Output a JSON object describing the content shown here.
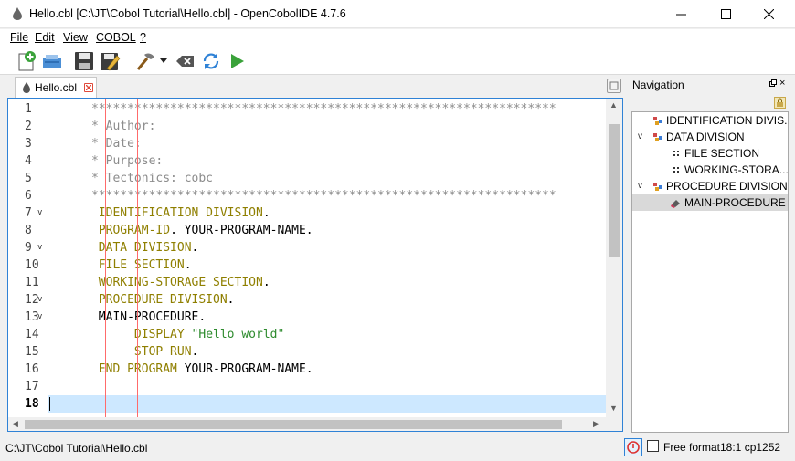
{
  "window": {
    "title": "Hello.cbl [C:\\JT\\Cobol Tutorial\\Hello.cbl] - OpenCobolIDE 4.7.6",
    "minimize_icon": "minimize-icon",
    "maximize_icon": "maximize-icon",
    "close_icon": "close-icon"
  },
  "menu": {
    "items": [
      {
        "label": "File",
        "mnemonic": "F"
      },
      {
        "label": "Edit",
        "mnemonic": "E"
      },
      {
        "label": "View",
        "mnemonic": "V"
      },
      {
        "label": "COBOL",
        "mnemonic": "C"
      },
      {
        "label": "?",
        "mnemonic": "?"
      }
    ]
  },
  "toolbar": {
    "buttons": [
      {
        "icon": "new-file-icon"
      },
      {
        "icon": "open-file-icon"
      },
      {
        "icon": "save-icon"
      },
      {
        "icon": "save-as-icon"
      },
      {
        "icon": "compile-hammer-icon"
      },
      {
        "icon": "dropdown-arrow-icon"
      },
      {
        "icon": "clear-icon"
      },
      {
        "icon": "refresh-icon"
      },
      {
        "icon": "run-icon"
      }
    ]
  },
  "tab": {
    "label": "Hello.cbl",
    "close_icon": "tab-close-icon"
  },
  "editor": {
    "current_line": 18,
    "lines": [
      {
        "n": "1",
        "fold": "",
        "tokens": [
          {
            "t": "      *****************************************************************",
            "c": "comment"
          }
        ]
      },
      {
        "n": "2",
        "fold": "",
        "tokens": [
          {
            "t": "      * Author:",
            "c": "comment"
          }
        ]
      },
      {
        "n": "3",
        "fold": "",
        "tokens": [
          {
            "t": "      * Date:",
            "c": "comment"
          }
        ]
      },
      {
        "n": "4",
        "fold": "",
        "tokens": [
          {
            "t": "      * Purpose:",
            "c": "comment"
          }
        ]
      },
      {
        "n": "5",
        "fold": "",
        "tokens": [
          {
            "t": "      * Tectonics: cobc",
            "c": "comment"
          }
        ]
      },
      {
        "n": "6",
        "fold": "",
        "tokens": [
          {
            "t": "      *****************************************************************",
            "c": "comment"
          }
        ]
      },
      {
        "n": "7",
        "fold": "v",
        "tokens": [
          {
            "t": "       IDENTIFICATION DIVISION",
            "c": "kw"
          },
          {
            "t": ".",
            "c": "id"
          }
        ]
      },
      {
        "n": "8",
        "fold": "",
        "tokens": [
          {
            "t": "       PROGRAM-ID",
            "c": "kw"
          },
          {
            "t": ". YOUR-PROGRAM-NAME.",
            "c": "id"
          }
        ]
      },
      {
        "n": "9",
        "fold": "v",
        "tokens": [
          {
            "t": "       DATA DIVISION",
            "c": "kw"
          },
          {
            "t": ".",
            "c": "id"
          }
        ]
      },
      {
        "n": "10",
        "fold": "",
        "tokens": [
          {
            "t": "       FILE SECTION",
            "c": "kw"
          },
          {
            "t": ".",
            "c": "id"
          }
        ]
      },
      {
        "n": "11",
        "fold": "",
        "tokens": [
          {
            "t": "       WORKING-STORAGE SECTION",
            "c": "kw"
          },
          {
            "t": ".",
            "c": "id"
          }
        ]
      },
      {
        "n": "12",
        "fold": "v",
        "tokens": [
          {
            "t": "       PROCEDURE DIVISION",
            "c": "kw"
          },
          {
            "t": ".",
            "c": "id"
          }
        ]
      },
      {
        "n": "13",
        "fold": "v",
        "tokens": [
          {
            "t": "       MAIN-PROCEDURE.",
            "c": "id"
          }
        ]
      },
      {
        "n": "14",
        "fold": "",
        "tokens": [
          {
            "t": "            DISPLAY ",
            "c": "kw"
          },
          {
            "t": "\"Hello world\"",
            "c": "str"
          }
        ]
      },
      {
        "n": "15",
        "fold": "",
        "tokens": [
          {
            "t": "            STOP RUN",
            "c": "kw"
          },
          {
            "t": ".",
            "c": "id"
          }
        ]
      },
      {
        "n": "16",
        "fold": "",
        "tokens": [
          {
            "t": "       END PROGRAM",
            "c": "kw"
          },
          {
            "t": " YOUR-PROGRAM-NAME.",
            "c": "id"
          }
        ]
      },
      {
        "n": "17",
        "fold": "",
        "tokens": []
      },
      {
        "n": "18",
        "fold": "",
        "tokens": []
      }
    ]
  },
  "navigation": {
    "title": "Navigation",
    "float_icon": "float-panel-icon",
    "close_label": "×",
    "lock_icon": "lock-icon",
    "tree": [
      {
        "label": "IDENTIFICATION DIVIS...",
        "level": 0,
        "chevron": "",
        "icon": "division-icon",
        "selected": false
      },
      {
        "label": "DATA DIVISION",
        "level": 0,
        "chevron": "v",
        "icon": "division-icon",
        "selected": false
      },
      {
        "label": "FILE SECTION",
        "level": 1,
        "chevron": "",
        "icon": "section-icon",
        "selected": false
      },
      {
        "label": "WORKING-STORA...",
        "level": 1,
        "chevron": "",
        "icon": "section-icon",
        "selected": false
      },
      {
        "label": "PROCEDURE DIVISION",
        "level": 0,
        "chevron": "v",
        "icon": "division-icon",
        "selected": false
      },
      {
        "label": "MAIN-PROCEDURE",
        "level": 1,
        "chevron": "",
        "icon": "paragraph-icon",
        "selected": true
      }
    ]
  },
  "status": {
    "path": "C:\\JT\\Cobol Tutorial\\Hello.cbl",
    "error_icon": "error-power-icon",
    "free_format_label": "Free format",
    "free_format_checked": false,
    "position": "18:1",
    "encoding": "cp1252"
  },
  "colors": {
    "keyword": "#8f7f00",
    "comment": "#8c8c8c",
    "string": "#2e8b2e",
    "current_line": "#cde8ff",
    "margin_line": "#ff6b6b",
    "accent": "#2f82d6"
  }
}
